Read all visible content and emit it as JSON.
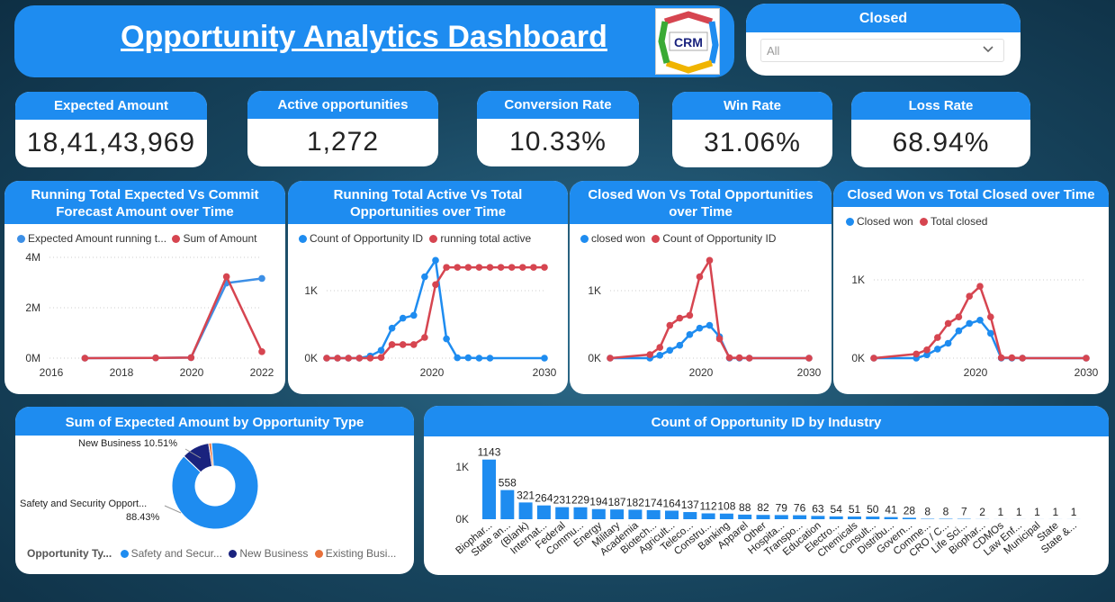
{
  "title": "Opportunity Analytics Dashboard",
  "logo": {
    "text": "CRM",
    "ring": [
      "SALES",
      "SERVICE",
      "SUPPORT",
      "LOYALTY"
    ]
  },
  "filter": {
    "label": "Closed",
    "value": "All"
  },
  "kpis": [
    {
      "label": "Expected Amount",
      "value": "18,41,43,969"
    },
    {
      "label": "Active opportunities",
      "value": "1,272"
    },
    {
      "label": "Conversion Rate",
      "value": "10.33%"
    },
    {
      "label": "Win Rate",
      "value": "31.06%"
    },
    {
      "label": "Loss Rate",
      "value": "68.94%"
    }
  ],
  "colors": {
    "blue": "#1e8cf0",
    "red": "#d64550",
    "navy": "#1a237e",
    "orange": "#e8703a"
  },
  "chart_data": [
    {
      "type": "line",
      "title": "Running Total Expected Vs Commit Forecast Amount over Time",
      "ylim": [
        0,
        4000000
      ],
      "yticks": [
        "4M",
        "2M",
        "0M"
      ],
      "xticks": [
        "2016",
        "2018",
        "2020",
        "2022"
      ],
      "xlim": [
        2016,
        2022
      ],
      "series": [
        {
          "name": "Expected Amount running t...",
          "color": "#3c8fe6",
          "x": [
            2017,
            2019,
            2020,
            2021,
            2022
          ],
          "values": [
            0,
            10000,
            20000,
            2900000,
            3080000
          ]
        },
        {
          "name": "Sum of Amount",
          "color": "#d64550",
          "x": [
            2017,
            2019,
            2020,
            2021,
            2022
          ],
          "values": [
            0,
            10000,
            20000,
            3150000,
            250000
          ]
        }
      ]
    },
    {
      "type": "line",
      "title": "Running Total Active Vs Total Opportunities over Time",
      "ylim": [
        0,
        1450
      ],
      "yticks": [
        "1K",
        "0K"
      ],
      "xticks": [
        "2020",
        "2030"
      ],
      "xlim": [
        2010,
        2030
      ],
      "series": [
        {
          "name": "Count of Opportunity ID",
          "color": "#1e8cf0",
          "x": [
            2010,
            2011,
            2012,
            2013,
            2014,
            2015,
            2016,
            2017,
            2018,
            2019,
            2020,
            2021,
            2022,
            2023,
            2024,
            2025,
            2030
          ],
          "values": [
            0,
            0,
            0,
            0,
            30,
            110,
            420,
            560,
            600,
            1140,
            1370,
            270,
            5,
            5,
            0,
            0,
            0
          ]
        },
        {
          "name": "running total active",
          "color": "#d64550",
          "x": [
            2010,
            2011,
            2012,
            2013,
            2014,
            2015,
            2016,
            2017,
            2018,
            2019,
            2020,
            2021,
            2022,
            2023,
            2024,
            2025,
            2026,
            2027,
            2028,
            2029,
            2030
          ],
          "values": [
            0,
            0,
            0,
            0,
            0,
            10,
            190,
            190,
            190,
            290,
            1030,
            1272,
            1272,
            1272,
            1272,
            1272,
            1272,
            1272,
            1272,
            1272,
            1272
          ]
        }
      ]
    },
    {
      "type": "line",
      "title": "Closed Won Vs Total Opportunities over Time",
      "ylim": [
        0,
        1450
      ],
      "yticks": [
        "1K",
        "0K"
      ],
      "xticks": [
        "2020",
        "2030"
      ],
      "xlim": [
        2010,
        2030
      ],
      "series": [
        {
          "name": "closed won",
          "color": "#1e8cf0",
          "x": [
            2010,
            2014,
            2015,
            2016,
            2017,
            2018,
            2019,
            2020,
            2021,
            2022,
            2023,
            2024,
            2030
          ],
          "values": [
            0,
            0,
            40,
            110,
            180,
            330,
            420,
            460,
            300,
            0,
            0,
            0,
            0
          ]
        },
        {
          "name": "Count of Opportunity ID",
          "color": "#d64550",
          "x": [
            2010,
            2014,
            2015,
            2016,
            2017,
            2018,
            2019,
            2020,
            2021,
            2022,
            2023,
            2024,
            2030
          ],
          "values": [
            0,
            50,
            150,
            460,
            560,
            600,
            1140,
            1370,
            270,
            5,
            5,
            0,
            0
          ]
        }
      ]
    },
    {
      "type": "line",
      "title": "Closed Won vs Total Closed over Time",
      "ylim": [
        0,
        1450
      ],
      "yticks": [
        "1K",
        "0K"
      ],
      "xticks": [
        "2020",
        "2030"
      ],
      "xlim": [
        2010,
        2030
      ],
      "series": [
        {
          "name": "Closed won",
          "color": "#1e8cf0",
          "x": [
            2010,
            2014,
            2015,
            2016,
            2017,
            2018,
            2019,
            2020,
            2021,
            2022,
            2023,
            2024,
            2030
          ],
          "values": [
            0,
            0,
            40,
            110,
            180,
            330,
            420,
            460,
            300,
            0,
            0,
            0,
            0
          ]
        },
        {
          "name": "Total closed",
          "color": "#d64550",
          "x": [
            2010,
            2014,
            2015,
            2016,
            2017,
            2018,
            2019,
            2020,
            2021,
            2022,
            2023,
            2024,
            2030
          ],
          "values": [
            0,
            50,
            100,
            250,
            420,
            500,
            750,
            870,
            500,
            5,
            5,
            0,
            0
          ]
        }
      ]
    },
    {
      "type": "pie",
      "title": "Sum of Expected Amount by Opportunity Type",
      "legend_title": "Opportunity Ty...",
      "labels": [
        "Safety and Secur...",
        "New Business",
        "Existing Busi..."
      ],
      "values": [
        88.43,
        10.51,
        1.06
      ],
      "colors": [
        "#1e8cf0",
        "#1a237e",
        "#e8703a"
      ],
      "annotations": [
        {
          "text": "New Business 10.51%"
        },
        {
          "text": "Safety and Security Opport..."
        },
        {
          "text": "88.43%"
        }
      ]
    },
    {
      "type": "bar",
      "title": "Count of Opportunity ID by Industry",
      "ylim": [
        0,
        1200
      ],
      "yticks": [
        "1K",
        "0K"
      ],
      "categories": [
        "Biophar...",
        "State an...",
        "(Blank)",
        "Internat...",
        "Federal",
        "Commu...",
        "Energy",
        "Military",
        "Academia",
        "Biotech...",
        "Agricult...",
        "Teleco...",
        "Constru...",
        "Banking",
        "Apparel",
        "Other",
        "Hospita...",
        "Transpo...",
        "Education",
        "Electro...",
        "Chemicals",
        "Consult...",
        "Distribu...",
        "Govern...",
        "Comme...",
        "CRO / C...",
        "Life Sci...",
        "Biophar...",
        "CDMOs",
        "Law Enf...",
        "Municipal",
        "State",
        "State &..."
      ],
      "values": [
        1143,
        558,
        321,
        264,
        231,
        229,
        194,
        187,
        182,
        174,
        164,
        137,
        112,
        108,
        88,
        82,
        79,
        76,
        63,
        54,
        51,
        50,
        41,
        28,
        8,
        8,
        7,
        2,
        1,
        1,
        1,
        1,
        1
      ]
    }
  ]
}
